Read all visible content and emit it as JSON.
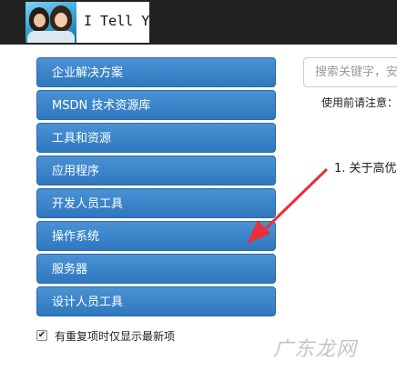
{
  "header": {
    "logo_text": "I Tell You"
  },
  "sidebar": {
    "items": [
      {
        "label": "企业解决方案"
      },
      {
        "label": "MSDN 技术资源库"
      },
      {
        "label": "工具和资源"
      },
      {
        "label": "应用程序"
      },
      {
        "label": "开发人员工具"
      },
      {
        "label": "操作系统"
      },
      {
        "label": "服务器"
      },
      {
        "label": "设计人员工具"
      }
    ],
    "checkbox": {
      "checked": true,
      "label": "有重复项时仅显示最新项"
    }
  },
  "main": {
    "search": {
      "placeholder": "搜索关键字，安",
      "value": ""
    },
    "notice_label": "使用前请注意：",
    "list_item_1": "1. 关于高优"
  },
  "overlay": {
    "arrow_color": "#e8303c",
    "watermark": "广东龙网"
  }
}
